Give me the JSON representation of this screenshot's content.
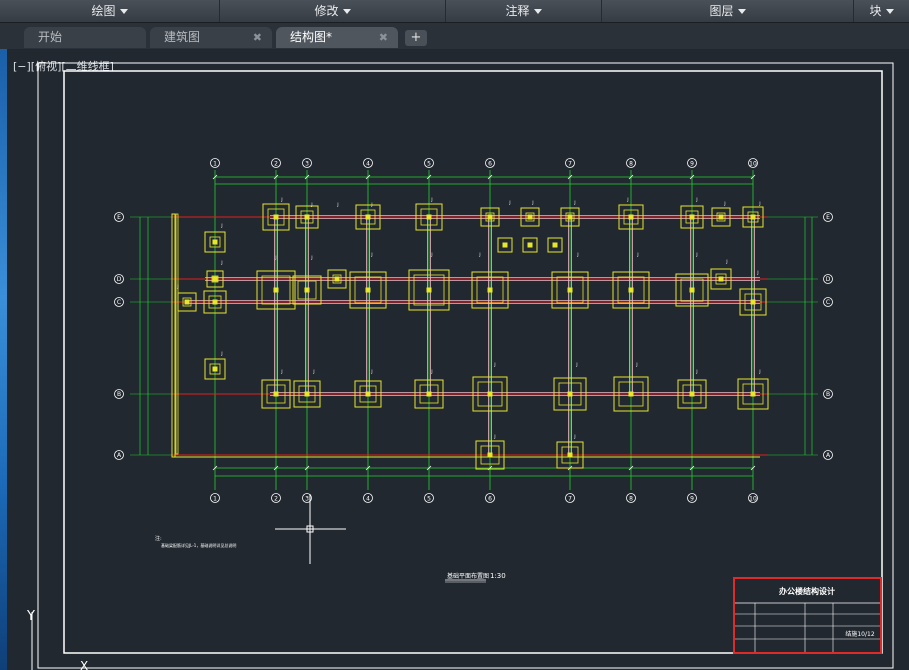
{
  "ribbon": {
    "panels": [
      {
        "label": "绘图"
      },
      {
        "label": "修改"
      },
      {
        "label": "注释"
      },
      {
        "label": "图层"
      },
      {
        "label": "块"
      }
    ]
  },
  "tabs": [
    {
      "label": "开始",
      "close": ""
    },
    {
      "label": "建筑图",
      "close": "✖"
    },
    {
      "label": "结构图*",
      "close": "✖"
    }
  ],
  "add_tab": "+",
  "view_label": "[−][俯视][二维线框]",
  "drawing": {
    "col_axes": [
      "1",
      "2",
      "3",
      "4",
      "5",
      "6",
      "7",
      "8",
      "9",
      "10"
    ],
    "row_axes": [
      "E",
      "D",
      "C",
      "B",
      "A"
    ],
    "plan_title": "基础平面布置图",
    "plan_scale": "1:30",
    "notes_title": "注:",
    "notes_text": "基础梁配筋详见JL-1，基础说明详见总说明",
    "title_block": {
      "project": "办公楼结构设计",
      "sheet_no": "结施10/12"
    }
  },
  "ucs": {
    "y": "Y",
    "x": "X"
  }
}
